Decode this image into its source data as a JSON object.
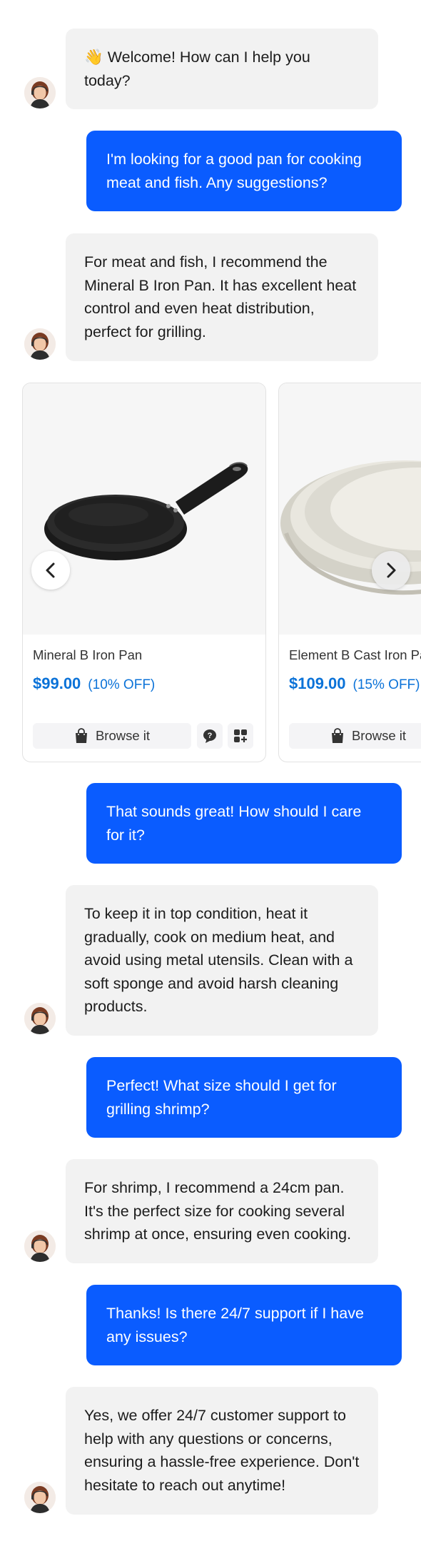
{
  "messages": [
    {
      "role": "bot",
      "emoji": "👋",
      "text": "Welcome! How can I help you today?"
    },
    {
      "role": "user",
      "text": "I'm looking for a good pan for cooking meat and fish. Any suggestions?"
    },
    {
      "role": "bot",
      "text": "For meat and fish, I recommend the Mineral B Iron Pan. It has excellent heat control and even heat distribution, perfect for grilling."
    },
    {
      "role": "user",
      "text": "That sounds great! How should I care for it?"
    },
    {
      "role": "bot",
      "text": "To keep it in top condition, heat it gradually, cook on medium heat, and avoid using metal utensils. Clean with a soft sponge and avoid harsh cleaning products."
    },
    {
      "role": "user",
      "text": "Perfect! What size should I get for grilling shrimp?"
    },
    {
      "role": "bot",
      "text": "For shrimp, I recommend a 24cm pan. It's the perfect size for cooking several shrimp at once, ensuring even cooking."
    },
    {
      "role": "user",
      "text": "Thanks! Is there 24/7 support if I have any issues?"
    },
    {
      "role": "bot",
      "text": "Yes, we offer 24/7 customer support to help with any questions or concerns, ensuring a hassle-free experience. Don't hesitate to reach out anytime!"
    }
  ],
  "products": [
    {
      "name": "Mineral B Iron Pan",
      "price": "$99.00",
      "discount": "(10% OFF)",
      "browse_label": "Browse it",
      "image_icon": "black-frying-pan"
    },
    {
      "name": "Element B Cast Iron Pan",
      "price": "$109.00",
      "discount": "(15% OFF)",
      "browse_label": "Browse it",
      "image_icon": "white-speckled-pan"
    }
  ],
  "colors": {
    "user_bubble": "#0a5cff",
    "bot_bubble": "#f2f2f2",
    "price": "#0a72d8"
  }
}
